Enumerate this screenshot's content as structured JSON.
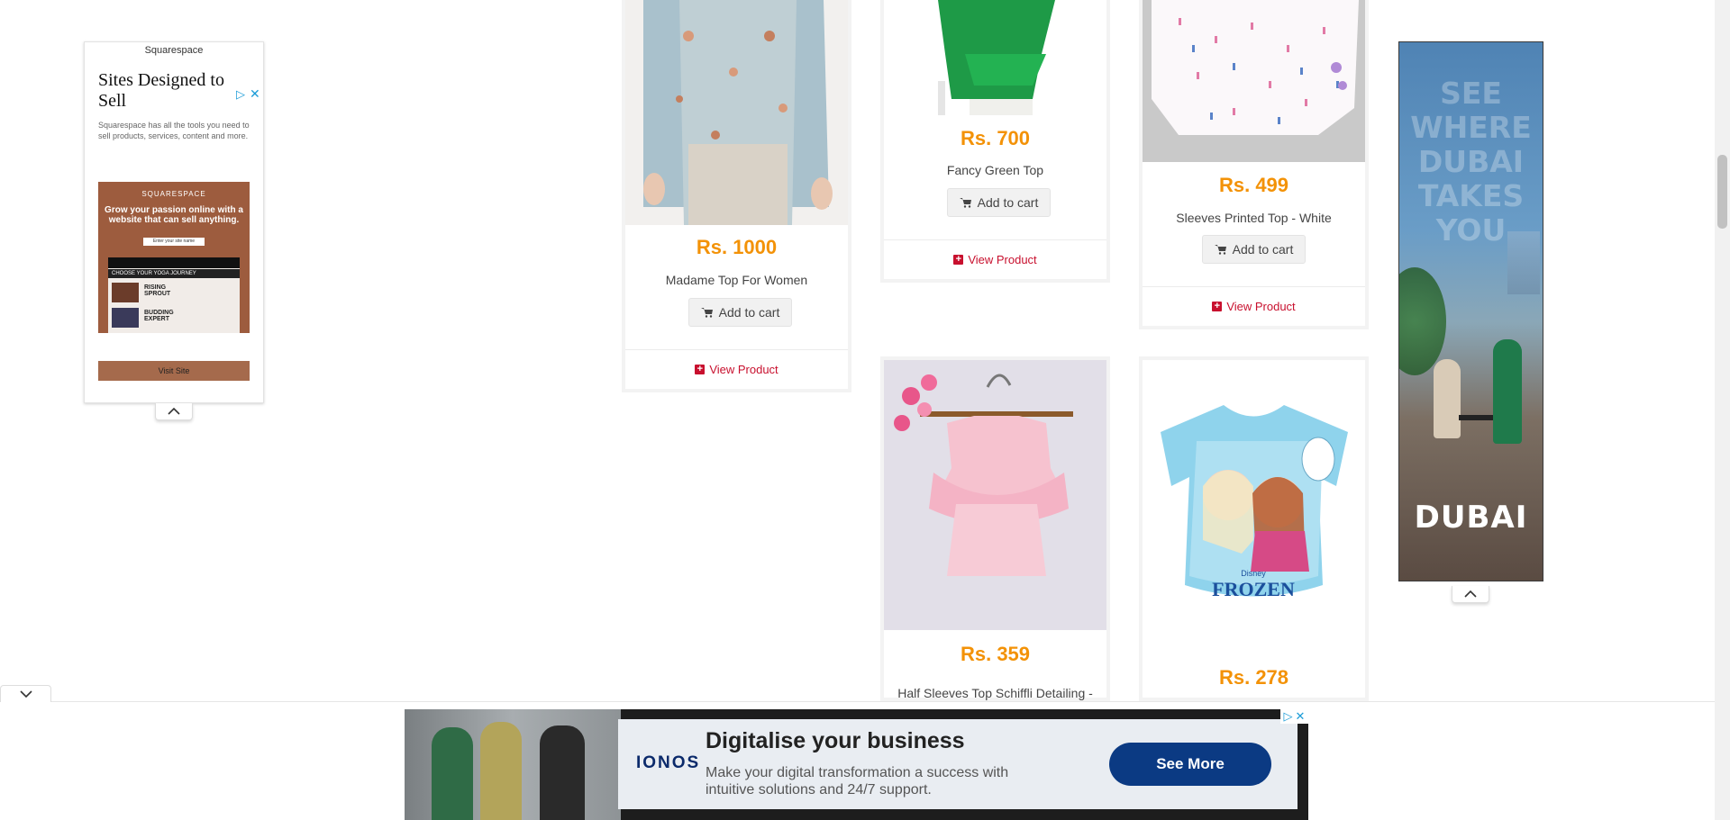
{
  "left_ad": {
    "brand": "Squarespace",
    "headline": "Sites Designed to Sell",
    "description": "Squarespace has all the tools you need to sell products, services, content and more.",
    "creative": {
      "logo": "SQUARESPACE",
      "headline": "Grow your passion online with a website that can sell anything.",
      "input_text": "Enter your site name",
      "journey_label": "CHOOSE YOUR YOGA JOURNEY",
      "item_1": "RISING SPROUT",
      "item_2": "BUDDING EXPERT"
    },
    "cta": "Visit Site"
  },
  "right_ad": {
    "tagline": "SEE WHERE DUBAI TAKES YOU",
    "logo": "DUBAI"
  },
  "products": [
    {
      "name": "Madame Top For Women",
      "price": "Rs. 1000",
      "cart_label": "Add to cart",
      "view_label": "View Product"
    },
    {
      "name": "Fancy Green Top",
      "price": "Rs. 700",
      "cart_label": "Add to cart",
      "view_label": "View Product"
    },
    {
      "name": "Sleeves Printed Top - White",
      "price": "Rs. 499",
      "cart_label": "Add to cart",
      "view_label": "View Product"
    },
    {
      "name": "Half Sleeves Top Schiffli Detailing -",
      "price": "Rs. 359"
    },
    {
      "name": "",
      "price": "Rs. 278",
      "image_text": "FROZEN",
      "image_brand": "Disney"
    }
  ],
  "bottom_ad": {
    "brand": "IONOS",
    "title": "Digitalise your business",
    "description": "Make your digital transformation a success with intuitive solutions and 24/7 support.",
    "cta": "See More"
  },
  "colors": {
    "price": "#f39207",
    "view_link": "#c8102e",
    "ionos_button": "#0b3a83"
  }
}
